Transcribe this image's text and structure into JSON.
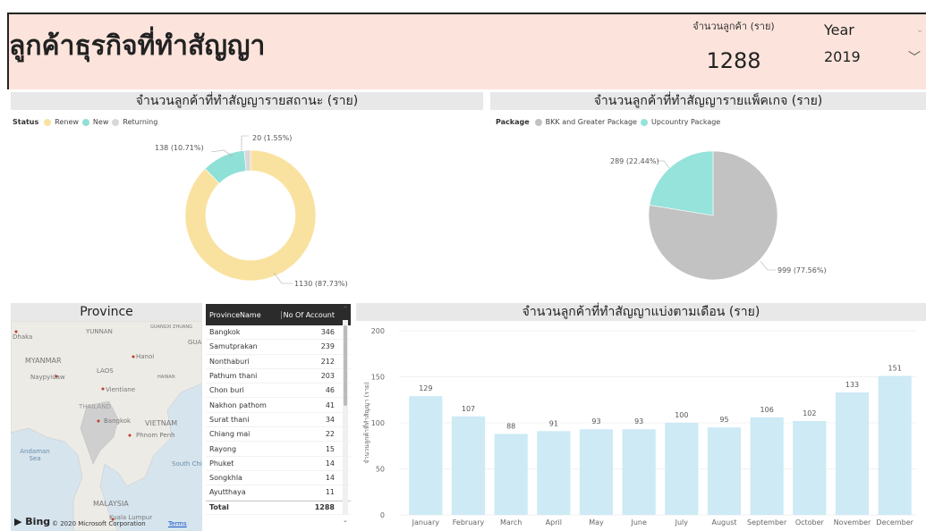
{
  "header": {
    "title": "ลูกค้าธุรกิจที่ทำสัญญา",
    "kpi_label": "จำนวนลูกค้า (ราย)",
    "kpi_value": "1288",
    "slicer_title": "Year",
    "slicer_value": "2019"
  },
  "sections": {
    "status": "จำนวนลูกค้าที่ทำสัญญารายสถานะ (ราย)",
    "package": "จำนวนลูกค้าที่ทำสัญญารายแพ็คเกจ (ราย)",
    "province": "Province",
    "monthly": "จำนวนลูกค้าที่ทำสัญญาแบ่งตามเดือน (ราย)"
  },
  "colors": {
    "renew": "#f9e2a0",
    "new": "#8fe0d6",
    "returning": "#d8d8d8",
    "bkk": "#c2c2c2",
    "upcountry": "#95e3db",
    "bar": "#cdeaf5"
  },
  "chart_data": [
    {
      "type": "pie",
      "variant": "donut",
      "legend_title": "Status",
      "labels": [
        "Renew",
        "New",
        "Returning"
      ],
      "values": [
        1130,
        138,
        20
      ],
      "data_labels": [
        "1130 (87.73%)",
        "138 (10.71%)",
        "20 (1.55%)"
      ]
    },
    {
      "type": "pie",
      "legend_title": "Package",
      "labels": [
        "BKK and Greater Package",
        "Upcountry Package"
      ],
      "values": [
        999,
        289
      ],
      "data_labels": [
        "999 (77.56%)",
        "289 (22.44%)"
      ]
    },
    {
      "type": "bar",
      "categories": [
        "January",
        "February",
        "March",
        "April",
        "May",
        "June",
        "July",
        "August",
        "September",
        "October",
        "November",
        "December"
      ],
      "values": [
        129,
        107,
        88,
        91,
        93,
        93,
        100,
        95,
        106,
        102,
        133,
        151
      ],
      "ylabel": "จำนวนลูกค้าที่ทำสัญญา (ราย)",
      "ylim": [
        0,
        200
      ],
      "yticks": [
        0,
        50,
        100,
        150,
        200
      ],
      "grid": true
    }
  ],
  "map": {
    "labels": [
      "Dhaka",
      "YUNNAN",
      "GUANGXI ZHUANG",
      "GUAN",
      "MYANMAR",
      "Hanoi",
      "LAOS",
      "HAINAN",
      "Naypyidaw",
      "Vientiane",
      "THAILAND",
      "Bangkok",
      "VIETNAM",
      "Phnom Penh",
      "Andaman Sea",
      "South China Sea",
      "MALAYSIA",
      "Kuala Lumpur"
    ],
    "provider": "Bing",
    "copyright": "© 2020 Microsoft Corporation",
    "terms": "Terms"
  },
  "table": {
    "col_name": "ProvinceName",
    "col_count": "No Of Account",
    "rows": [
      {
        "name": "Bangkok",
        "count": "346"
      },
      {
        "name": "Samutprakan",
        "count": "239"
      },
      {
        "name": "Nonthaburi",
        "count": "212"
      },
      {
        "name": "Pathum thani",
        "count": "203"
      },
      {
        "name": "Chon buri",
        "count": "46"
      },
      {
        "name": "Nakhon pathom",
        "count": "41"
      },
      {
        "name": "Surat thani",
        "count": "34"
      },
      {
        "name": "Chiang mai",
        "count": "22"
      },
      {
        "name": "Rayong",
        "count": "15"
      },
      {
        "name": "Phuket",
        "count": "14"
      },
      {
        "name": "Songkhla",
        "count": "14"
      },
      {
        "name": "Ayutthaya",
        "count": "11"
      }
    ],
    "total_label": "Total",
    "total_value": "1288"
  }
}
